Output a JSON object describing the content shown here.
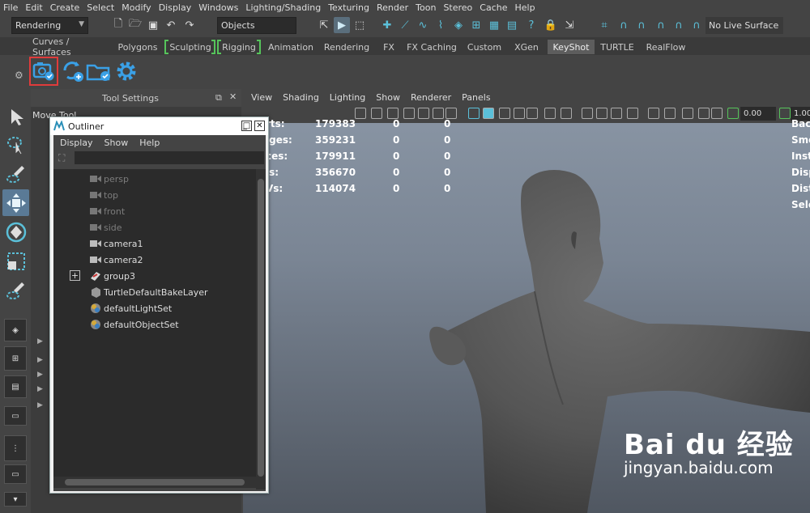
{
  "menubar": [
    "File",
    "Edit",
    "Create",
    "Select",
    "Modify",
    "Display",
    "Windows",
    "Lighting/Shading",
    "Texturing",
    "Render",
    "Toon",
    "Stereo",
    "Cache",
    "Help"
  ],
  "status": {
    "mode": "Rendering",
    "selection_mode": "Objects",
    "live_surface": "No Live Surface"
  },
  "shelf_tabs": [
    "Curves / Surfaces",
    "Polygons",
    "Sculpting",
    "Rigging",
    "Animation",
    "Rendering",
    "FX",
    "FX Caching",
    "Custom",
    "XGen",
    "KeyShot",
    "TURTLE",
    "RealFlow"
  ],
  "active_shelf_tab": "KeyShot",
  "tool_settings": {
    "title": "Tool Settings",
    "tool_name": "Move Tool"
  },
  "viewport": {
    "menu": [
      "View",
      "Shading",
      "Lighting",
      "Show",
      "Renderer",
      "Panels"
    ],
    "field1": "0.00",
    "field2": "1.00",
    "hud_labels": [
      "rts:",
      "lges:",
      "ces:",
      "is:",
      "Vs:"
    ],
    "hud_col1": [
      "179383",
      "359231",
      "179911",
      "356670",
      "114074"
    ],
    "hud_col2": [
      "0",
      "0",
      "0",
      "0",
      "0"
    ],
    "hud_col3": [
      "0",
      "0",
      "0",
      "0",
      "0"
    ],
    "hud_right": [
      "Bac",
      "Smo",
      "Inst",
      "Disp",
      "Dist",
      "Sele"
    ]
  },
  "outliner": {
    "title": "Outliner",
    "menu": [
      "Display",
      "Show",
      "Help"
    ],
    "items": [
      {
        "label": "persp",
        "icon": "camera-icon",
        "dim": true
      },
      {
        "label": "top",
        "icon": "camera-icon",
        "dim": true
      },
      {
        "label": "front",
        "icon": "camera-icon",
        "dim": true
      },
      {
        "label": "side",
        "icon": "camera-icon",
        "dim": true
      },
      {
        "label": "camera1",
        "icon": "camera-icon",
        "dim": false
      },
      {
        "label": "camera2",
        "icon": "camera-icon",
        "dim": false
      },
      {
        "label": "group3",
        "icon": "group-icon",
        "dim": false
      },
      {
        "label": "TurtleDefaultBakeLayer",
        "icon": "bake-layer-icon",
        "dim": false
      },
      {
        "label": "defaultLightSet",
        "icon": "set-icon",
        "dim": false
      },
      {
        "label": "defaultObjectSet",
        "icon": "set-icon",
        "dim": false
      }
    ]
  },
  "watermark": {
    "logo": "Bai du 经验",
    "url": "jingyan.baidu.com"
  },
  "colors": {
    "accent_blue": "#5bc0d9",
    "selection_red": "#e03b3b",
    "bracket_green": "#56c45b"
  }
}
